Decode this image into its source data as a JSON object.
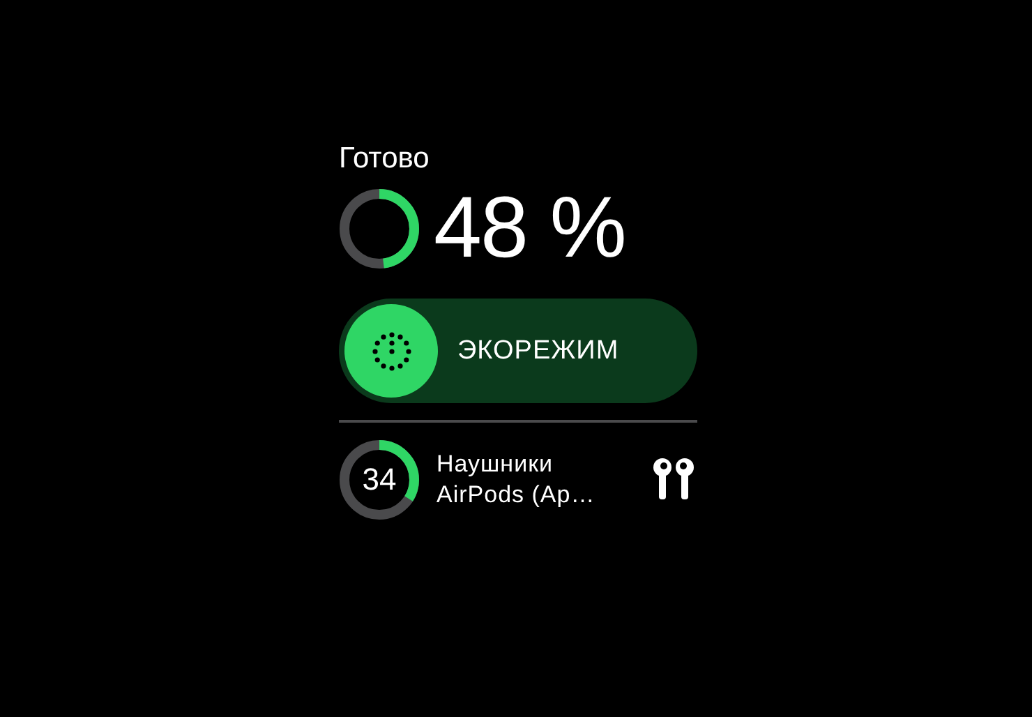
{
  "status": {
    "label": "Готово",
    "percent": "48 %",
    "level": 0.48
  },
  "eco_mode": {
    "label": "ЭКОРЕЖИМ",
    "on": true
  },
  "devices": [
    {
      "charge": "34",
      "level": 0.34,
      "kind": "earbuds",
      "lines": [
        "Наушники",
        "AirPods (Ap…"
      ]
    }
  ]
}
